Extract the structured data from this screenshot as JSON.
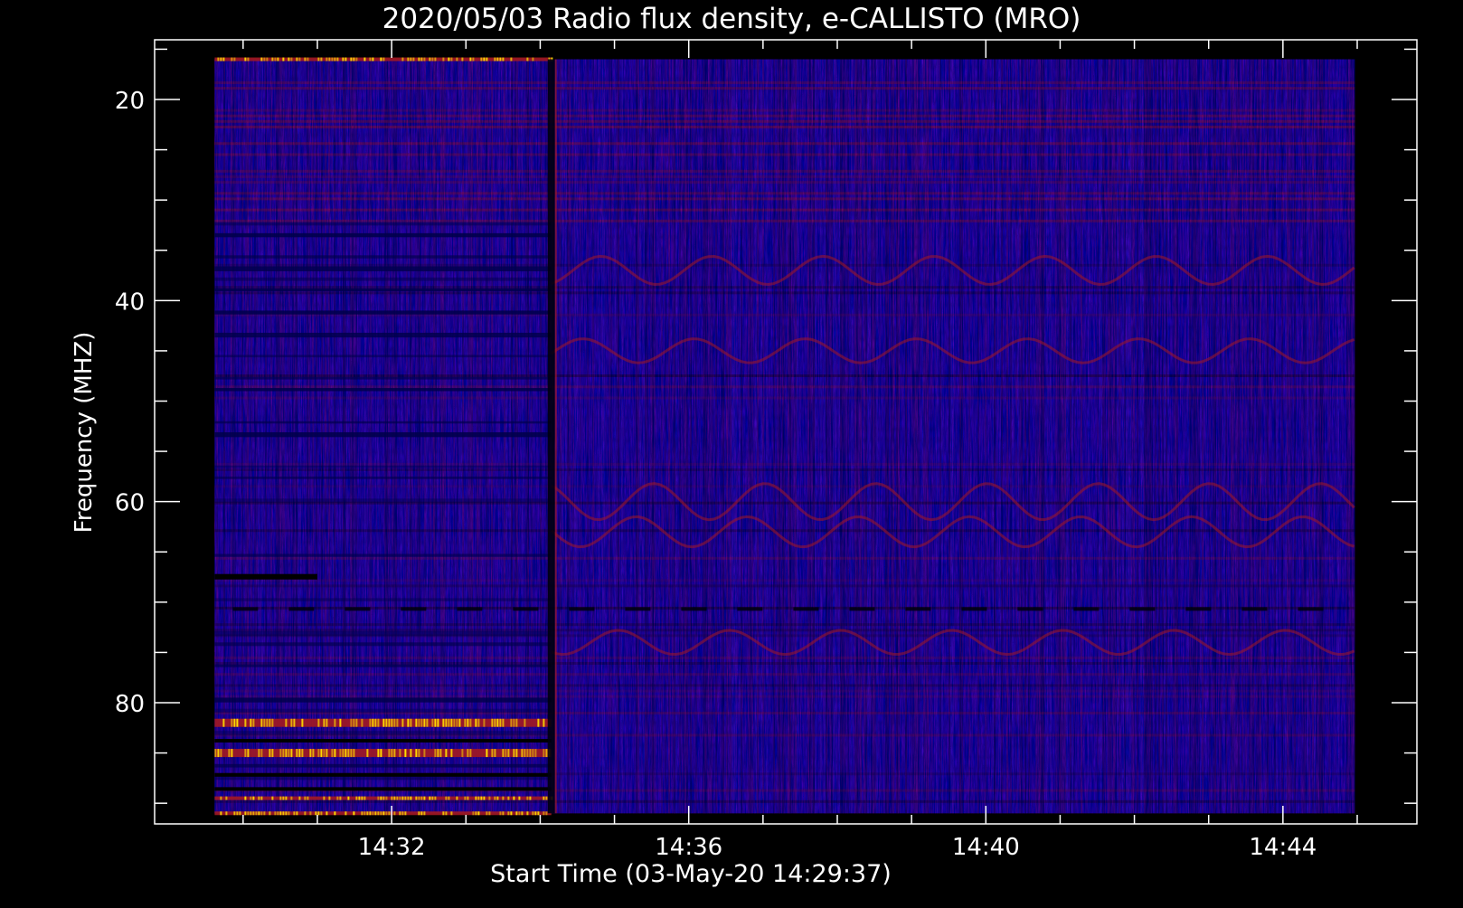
{
  "chart_data": {
    "type": "heatmap",
    "title": "2020/05/03  Radio flux density, e-CALLISTO (MRO)",
    "xlabel": "Start Time (03-May-20 14:29:37)",
    "ylabel": "Frequency (MHZ)",
    "x_ticks": [
      "14:32",
      "14:36",
      "14:40",
      "14:44"
    ],
    "x_tick_minutes": [
      32,
      36,
      40,
      44
    ],
    "x_range_minutes": [
      29.6,
      45.0
    ],
    "y_ticks": [
      20,
      40,
      60,
      80
    ],
    "ylim": [
      14,
      92
    ],
    "data_freq_range": [
      16,
      91
    ],
    "data_time_range_minutes": [
      29.617,
      44.967
    ],
    "y_reversed": true,
    "colors": {
      "background": "#000000",
      "axes": "#ffffff",
      "low": "#0000c8",
      "mid": "#2a1ee6",
      "high": "#a31822",
      "peak": "#ffe000"
    },
    "strong_bands_mhz": [
      16,
      82,
      85,
      89.5,
      91
    ],
    "dropout_minute": 34.15
  }
}
